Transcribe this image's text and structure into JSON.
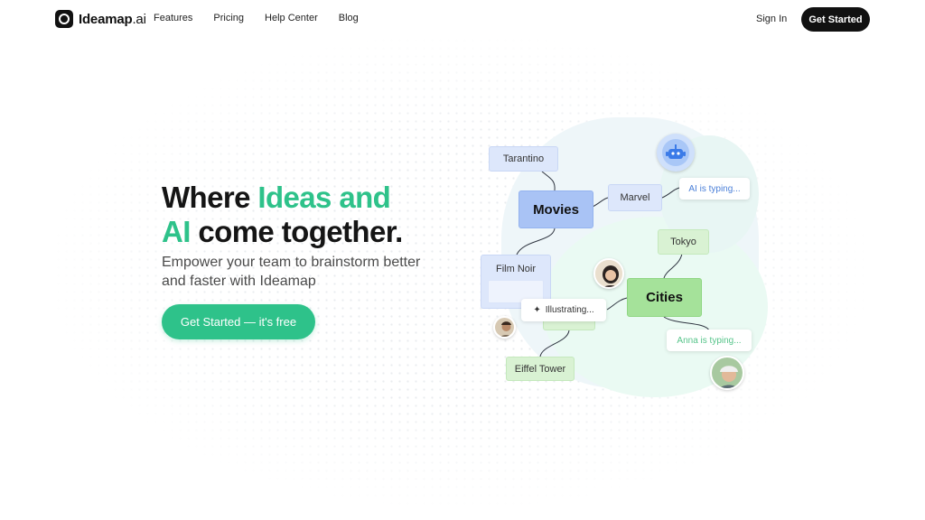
{
  "brand": {
    "name": "Ideamap",
    "tld": ".ai"
  },
  "nav": {
    "links": [
      "Features",
      "Pricing",
      "Help Center",
      "Blog"
    ],
    "sign_in": "Sign In",
    "get_started": "Get Started"
  },
  "hero": {
    "headline_1": "Where ",
    "headline_2": "Ideas and",
    "headline_3": "AI",
    "headline_4": " come together.",
    "subtitle": "Empower your team to brainstorm better and faster with Ideamap",
    "cta": "Get Started — it's free"
  },
  "mindmap": {
    "tarantino": "Tarantino",
    "movies": "Movies",
    "marvel": "Marvel",
    "ai_typing": "AI is typing...",
    "tokyo": "Tokyo",
    "film_noir": "Film Noir",
    "cities": "Cities",
    "illustrating": "Illustrating...",
    "anna_typing": "Anna is typing...",
    "eiffel": "Eiffel Tower"
  },
  "colors": {
    "accent": "#2ec28a",
    "dark": "#111111"
  }
}
